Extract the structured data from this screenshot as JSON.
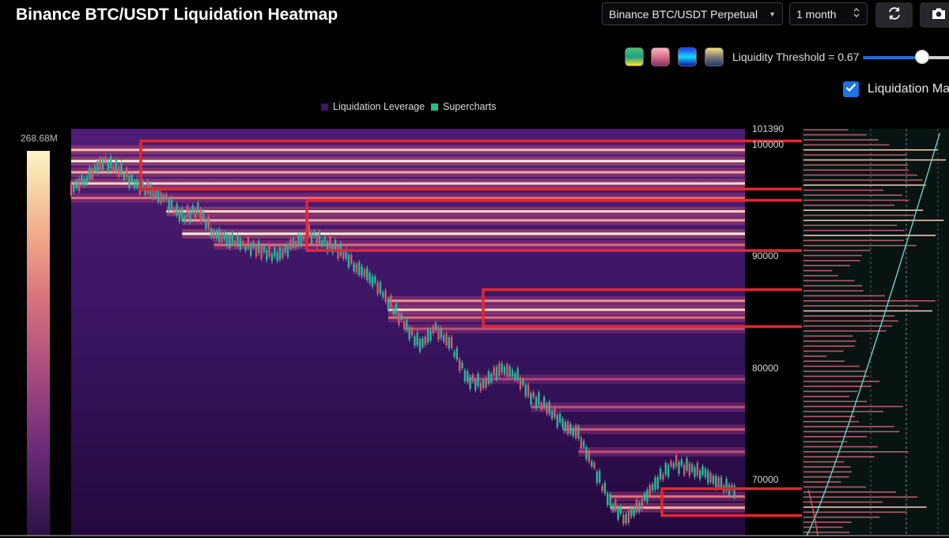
{
  "header": {
    "title": "Binance BTC/USDT Liquidation Heatmap",
    "market_select": "Binance BTC/USDT Perpetual",
    "range_select": "1 month"
  },
  "controls": {
    "swatches": [
      {
        "name": "viridis-palette",
        "colors": [
          "#4ac16d",
          "#1f9e89",
          "#fde725"
        ]
      },
      {
        "name": "magma-palette",
        "colors": [
          "#f7b7c4",
          "#d9708a",
          "#8a2f64"
        ]
      },
      {
        "name": "blue-palette",
        "colors": [
          "#1a3cff",
          "#18d7ff",
          "#0a1aa8"
        ]
      },
      {
        "name": "cividis-palette",
        "colors": [
          "#f4e27a",
          "#7c7b78",
          "#233a6b"
        ]
      }
    ],
    "threshold_label": "Liquidity Threshold = 0.67",
    "threshold_value": 0.67,
    "checkbox_label": "Liquidation Map",
    "checkbox_checked": true
  },
  "legend": {
    "items": [
      {
        "label": "Liquidation Leverage",
        "color": "#3d1760"
      },
      {
        "label": "Supercharts",
        "color": "#1ec48a"
      }
    ]
  },
  "colorbar": {
    "max_label": "268.68M"
  },
  "chart_data": {
    "type": "heatmap",
    "title": "Binance BTC/USDT Liquidation Heatmap",
    "y_axis": {
      "labels": [
        "101390",
        "100000",
        "90000",
        "80000",
        "70000"
      ],
      "ylim": [
        65000,
        101390
      ]
    },
    "colorscale_max": "268.68M",
    "price_series_approx": [
      96000,
      97000,
      98500,
      97800,
      96500,
      95800,
      95000,
      93500,
      94200,
      92000,
      91500,
      91000,
      90500,
      90000,
      91000,
      92000,
      91200,
      90500,
      89000,
      88000,
      86000,
      84000,
      82000,
      83500,
      82000,
      79000,
      78500,
      80000,
      79500,
      77500,
      76500,
      75000,
      74000,
      71000,
      68000,
      66500,
      68000,
      70000,
      71500,
      71000,
      70500,
      69500,
      69000
    ],
    "liquidation_bands": [
      {
        "price": 99500,
        "intensity": 0.9
      },
      {
        "price": 98500,
        "intensity": 1.0
      },
      {
        "price": 97500,
        "intensity": 0.85
      },
      {
        "price": 96500,
        "intensity": 0.95
      },
      {
        "price": 95200,
        "intensity": 0.7
      },
      {
        "price": 94000,
        "intensity": 0.95
      },
      {
        "price": 93200,
        "intensity": 0.85
      },
      {
        "price": 92000,
        "intensity": 1.0
      },
      {
        "price": 91000,
        "intensity": 0.7
      },
      {
        "price": 86000,
        "intensity": 0.8
      },
      {
        "price": 85200,
        "intensity": 0.95
      },
      {
        "price": 84500,
        "intensity": 0.7
      },
      {
        "price": 83500,
        "intensity": 0.55
      },
      {
        "price": 79000,
        "intensity": 0.5
      },
      {
        "price": 76500,
        "intensity": 0.55
      },
      {
        "price": 74500,
        "intensity": 0.6
      },
      {
        "price": 72500,
        "intensity": 0.55
      },
      {
        "price": 68500,
        "intensity": 0.7
      },
      {
        "price": 67500,
        "intensity": 0.85
      }
    ],
    "highlight_boxes": [
      {
        "price_top": 100300,
        "price_bottom": 96000
      },
      {
        "price_top": 95000,
        "price_bottom": 90500
      },
      {
        "price_top": 87000,
        "price_bottom": 83700
      },
      {
        "price_top": 69200,
        "price_bottom": 66800
      }
    ],
    "grid": false
  }
}
